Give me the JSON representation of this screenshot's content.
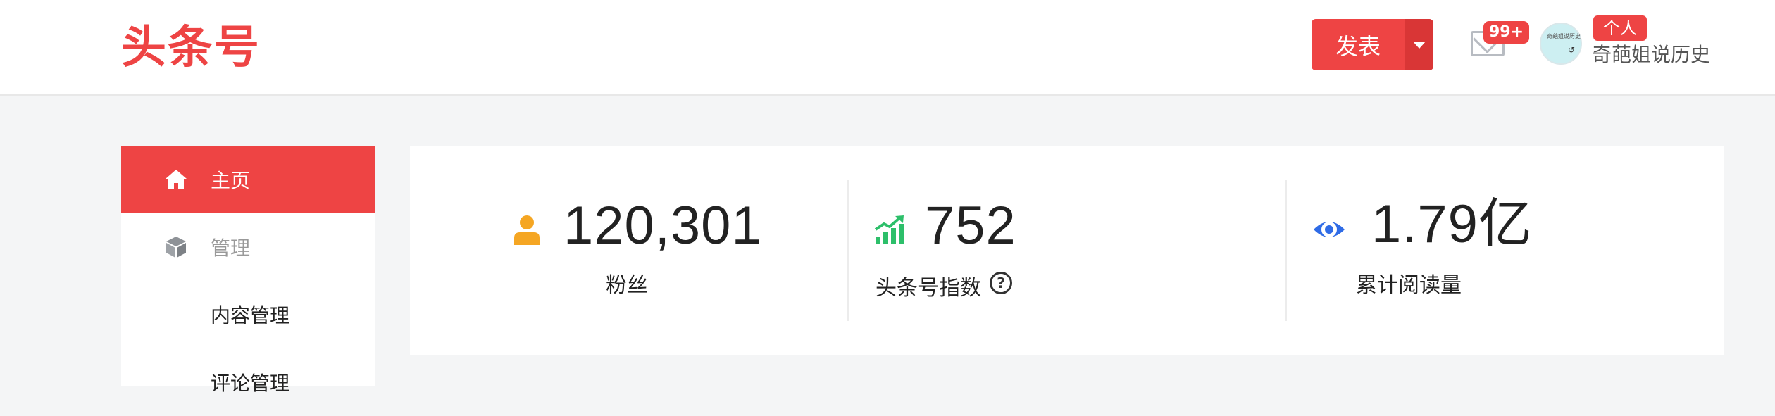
{
  "header": {
    "logo": "头条号",
    "publish_label": "发表",
    "messages_badge": "99+",
    "personal_badge": "个人",
    "username": "奇葩姐说历史",
    "avatar_text": "奇葩姐说历史"
  },
  "sidebar": {
    "items": [
      {
        "label": "主页",
        "icon": "home-icon",
        "active": true
      },
      {
        "label": "管理",
        "icon": "cube-icon",
        "active": false
      },
      {
        "label": "内容管理",
        "active": false
      },
      {
        "label": "评论管理",
        "active": false
      }
    ]
  },
  "stats": [
    {
      "value": "120,301",
      "label": "粉丝",
      "icon": "user-icon",
      "color": "#f5a623"
    },
    {
      "value": "752",
      "label": "头条号指数",
      "icon": "trend-chart-icon",
      "color": "#2dbf6a",
      "help": "?"
    },
    {
      "value": "1.79亿",
      "label": "累计阅读量",
      "icon": "eye-icon",
      "color": "#2f6be6"
    }
  ],
  "colors": {
    "brand": "#ee4444",
    "background": "#f4f5f6"
  }
}
